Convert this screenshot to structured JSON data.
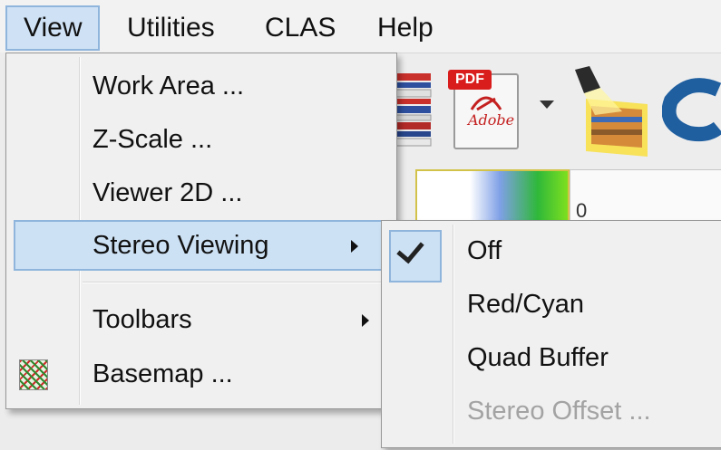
{
  "menubar": {
    "items": [
      "View",
      "Utilities",
      "CLAS",
      "Help"
    ]
  },
  "toolbar": {
    "pdf_label": "PDF",
    "pdf_brand": "Adobe",
    "icons": [
      "book-stack-icon",
      "pdf-icon",
      "dropdown-arrow-icon",
      "layer-cube-icon",
      "partial-logo-icon"
    ]
  },
  "colorbar": {
    "value": "0"
  },
  "view_menu": {
    "items": [
      {
        "label": "Work Area ..."
      },
      {
        "label": "Z-Scale ..."
      },
      {
        "label": "Viewer 2D ..."
      },
      {
        "label": "Stereo Viewing",
        "submenu": true,
        "highlighted": true
      },
      {
        "label": "Toolbars",
        "submenu": true
      },
      {
        "label": "Basemap ...",
        "icon": "basemap-icon"
      }
    ]
  },
  "stereo_submenu": {
    "items": [
      {
        "label": "Off",
        "checked": true
      },
      {
        "label": "Red/Cyan"
      },
      {
        "label": "Quad Buffer"
      },
      {
        "label": "Stereo Offset ...",
        "disabled": true
      }
    ]
  },
  "colors": {
    "highlight": "#cde1f4",
    "highlight_border": "#8fb5dc",
    "disabled_text": "#a3a3a3"
  }
}
